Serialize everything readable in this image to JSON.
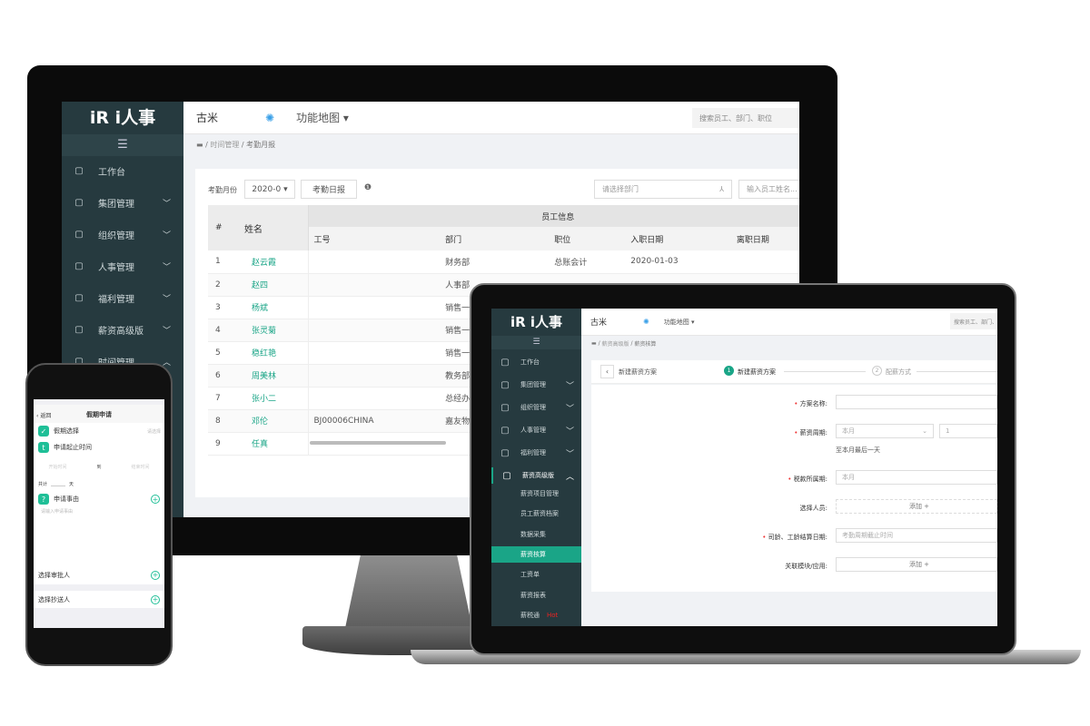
{
  "brand": {
    "logo": "iR i人事",
    "accent": "#1aa587",
    "sidebar_bg": "#263a3f"
  },
  "desktop": {
    "header": {
      "company": "古米",
      "nav_menu": "功能地图",
      "search_placeholder": "搜索员工、部门、职位"
    },
    "sidebar": {
      "menu_icon": "hamburger-icon",
      "items": [
        {
          "label": "工作台",
          "icon": "monitor-icon"
        },
        {
          "label": "集团管理",
          "icon": "group-icon"
        },
        {
          "label": "组织管理",
          "icon": "org-icon"
        },
        {
          "label": "人事管理",
          "icon": "person-icon"
        },
        {
          "label": "福利管理",
          "icon": "gift-icon"
        },
        {
          "label": "薪资高级版",
          "icon": "wallet-icon"
        },
        {
          "label": "时间管理",
          "icon": "clock-icon"
        }
      ]
    },
    "breadcrumb": [
      "时间管理",
      "考勤月报"
    ],
    "toolbar": {
      "month_label": "考勤月份",
      "month_value": "2020-0",
      "daily_report": "考勤日报",
      "dept_placeholder": "请选择部门",
      "name_placeholder": "输入员工姓名..."
    },
    "table": {
      "group_header": "员工信息",
      "columns": [
        "#",
        "姓名",
        "工号",
        "部门",
        "职位",
        "入职日期",
        "离职日期"
      ],
      "rows": [
        [
          "1",
          "赵云霞",
          "",
          "财务部",
          "总账会计",
          "2020-01-03",
          ""
        ],
        [
          "2",
          "赵四",
          "",
          "人事部",
          "",
          "",
          ""
        ],
        [
          "3",
          "杨斌",
          "",
          "销售一部二组",
          "",
          "",
          ""
        ],
        [
          "4",
          "张灵菊",
          "",
          "销售一部一组",
          "",
          "",
          ""
        ],
        [
          "5",
          "稳红艳",
          "",
          "销售一部一组",
          "",
          "",
          ""
        ],
        [
          "6",
          "周美林",
          "",
          "教务部",
          "",
          "",
          ""
        ],
        [
          "7",
          "张小二",
          "",
          "总经办",
          "",
          "",
          ""
        ],
        [
          "8",
          "邓伦",
          "BJ00006CHINA",
          "嘉友物流",
          "",
          "",
          ""
        ],
        [
          "9",
          "任真",
          "",
          "",
          "",
          "",
          ""
        ]
      ]
    }
  },
  "laptop": {
    "header": {
      "company": "古米",
      "nav_menu": "功能地图",
      "search_placeholder": "搜索员工、部门、"
    },
    "sidebar": {
      "items": [
        {
          "label": "工作台",
          "icon": "monitor-icon"
        },
        {
          "label": "集团管理",
          "icon": "group-icon"
        },
        {
          "label": "组织管理",
          "icon": "org-icon"
        },
        {
          "label": "人事管理",
          "icon": "person-icon"
        },
        {
          "label": "福利管理",
          "icon": "gift-icon"
        },
        {
          "label": "薪资高级版",
          "icon": "wallet-icon"
        }
      ],
      "sub_items": [
        "薪资项目管理",
        "员工薪资档案",
        "数据采集",
        "薪资核算",
        "工资单",
        "薪资报表",
        "薪税通"
      ],
      "active_sub": "薪资核算",
      "hot_badge": "Hot"
    },
    "breadcrumb": [
      "薪资高级版",
      "薪资核算"
    ],
    "steps": {
      "back_label": "新建薪资方案",
      "step1_num": "1",
      "step1": "新建薪资方案",
      "step2_num": "2",
      "step2": "配薪方式"
    },
    "form": {
      "plan_name": "方案名称:",
      "cycle": "薪资周期:",
      "cycle_value": "本月",
      "cycle_day": "1",
      "cycle_hint": "至本月最后一天",
      "tax_period": "税款所属期:",
      "tax_value": "本月",
      "select_people": "选择人员:",
      "add": "添加 +",
      "seniority_date": "司龄、工龄结算日期:",
      "seniority_placeholder": "考勤周期截止时间",
      "linked": "关联模块/应用:",
      "add2": "添加 +"
    }
  },
  "phone": {
    "nav": {
      "back": "返回",
      "title": "假期申请"
    },
    "leave_type": {
      "label": "假期选择",
      "placeholder": "请选择"
    },
    "period": {
      "label": "申请起止时间",
      "start": "开始时间",
      "to": "到",
      "end": "结束时间"
    },
    "total": {
      "label": "共计",
      "unit": "天"
    },
    "reason": {
      "label": "申请事由",
      "placeholder": "请输入申请事由"
    },
    "approver": "选择审批人",
    "cc": "选择抄送人"
  }
}
